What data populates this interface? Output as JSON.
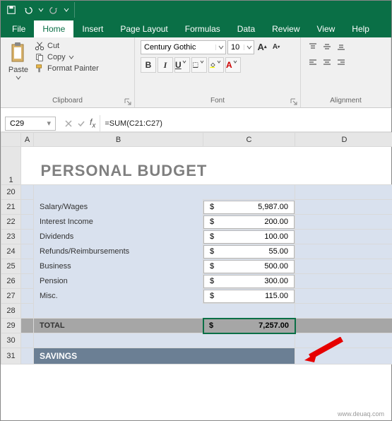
{
  "qat": {
    "save": "save",
    "undo": "undo",
    "redo": "redo"
  },
  "menu": {
    "file": "File",
    "home": "Home",
    "insert": "Insert",
    "pagelayout": "Page Layout",
    "formulas": "Formulas",
    "data": "Data",
    "review": "Review",
    "view": "View",
    "help": "Help"
  },
  "ribbon": {
    "clipboard": {
      "paste": "Paste",
      "cut": "Cut",
      "copy": "Copy",
      "formatpainter": "Format Painter",
      "group_label": "Clipboard"
    },
    "font": {
      "fontname": "Century Gothic",
      "fontsize": "10",
      "bold": "B",
      "italic": "I",
      "underline": "U",
      "group_label": "Font",
      "incfont": "A",
      "decfont": "A"
    },
    "alignment": {
      "group_label": "Alignment"
    }
  },
  "namebox": "C29",
  "formula": "=SUM(C21:C27)",
  "columns": {
    "A": "A",
    "B": "B",
    "C": "C",
    "D": "D"
  },
  "doc": {
    "title": "PERSONAL BUDGET",
    "rows": [
      {
        "num": "21",
        "label": "Salary/Wages",
        "amount": "5,987.00"
      },
      {
        "num": "22",
        "label": "Interest Income",
        "amount": "200.00"
      },
      {
        "num": "23",
        "label": "Dividends",
        "amount": "100.00"
      },
      {
        "num": "24",
        "label": "Refunds/Reimbursements",
        "amount": "55.00"
      },
      {
        "num": "25",
        "label": "Business",
        "amount": "500.00"
      },
      {
        "num": "26",
        "label": "Pension",
        "amount": "300.00"
      },
      {
        "num": "27",
        "label": "Misc.",
        "amount": "115.00"
      }
    ],
    "total_label": "TOTAL",
    "total_amount": "7,257.00",
    "currency": "$",
    "savings": "SAVINGS"
  },
  "rownums": {
    "r1": "1",
    "r20": "20",
    "r28": "28",
    "r29": "29",
    "r30": "30",
    "r31": "31"
  },
  "watermark": "www.deuaq.com"
}
